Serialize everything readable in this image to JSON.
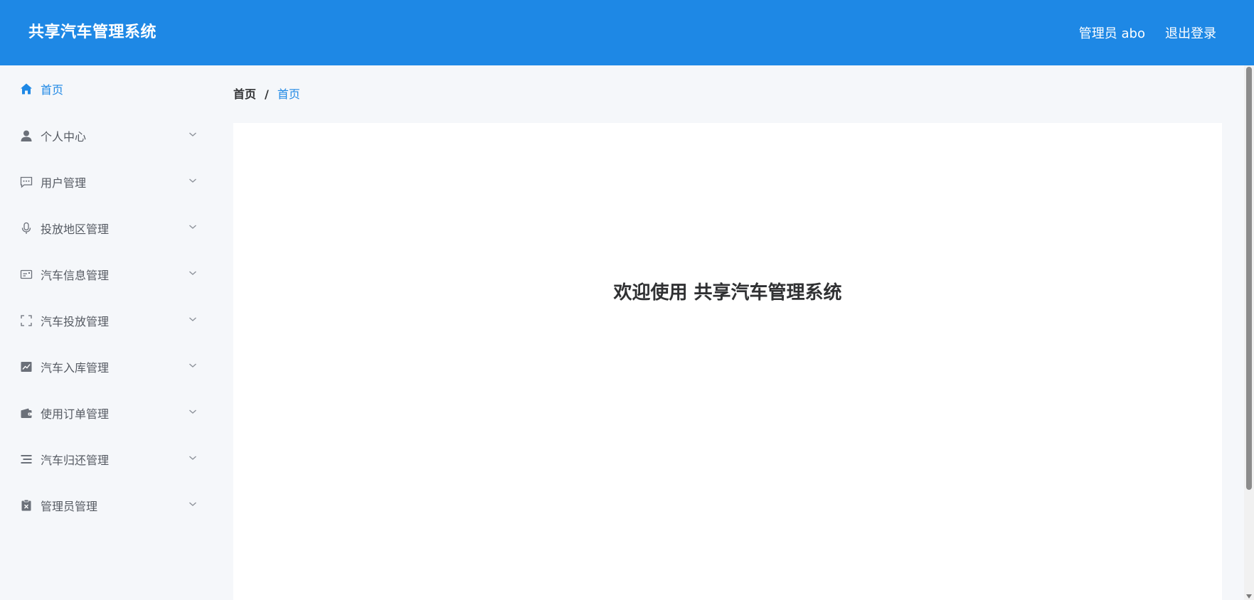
{
  "header": {
    "app_title": "共享汽车管理系统",
    "user_label": "管理员 abo",
    "logout_label": "退出登录",
    "bg_color": "#1e88e5"
  },
  "sidebar": {
    "items": [
      {
        "label": "首页",
        "icon": "home-icon",
        "active": true
      },
      {
        "label": "个人中心",
        "icon": "user-icon"
      },
      {
        "label": "用户管理",
        "icon": "chat-dots-icon"
      },
      {
        "label": "投放地区管理",
        "icon": "microphone-icon"
      },
      {
        "label": "汽车信息管理",
        "icon": "card-icon"
      },
      {
        "label": "汽车投放管理",
        "icon": "fullscreen-icon"
      },
      {
        "label": "汽车入库管理",
        "icon": "chart-icon"
      },
      {
        "label": "使用订单管理",
        "icon": "wallet-icon"
      },
      {
        "label": "汽车归还管理",
        "icon": "list-icon"
      },
      {
        "label": "管理员管理",
        "icon": "clipboard-x-icon"
      }
    ]
  },
  "breadcrumb": {
    "root": "首页",
    "separator": "/",
    "current": "首页"
  },
  "main": {
    "welcome_text": "欢迎使用 共享汽车管理系统"
  },
  "colors": {
    "accent": "#1e88e5",
    "text": "#303133",
    "menu_text": "#555a62"
  }
}
